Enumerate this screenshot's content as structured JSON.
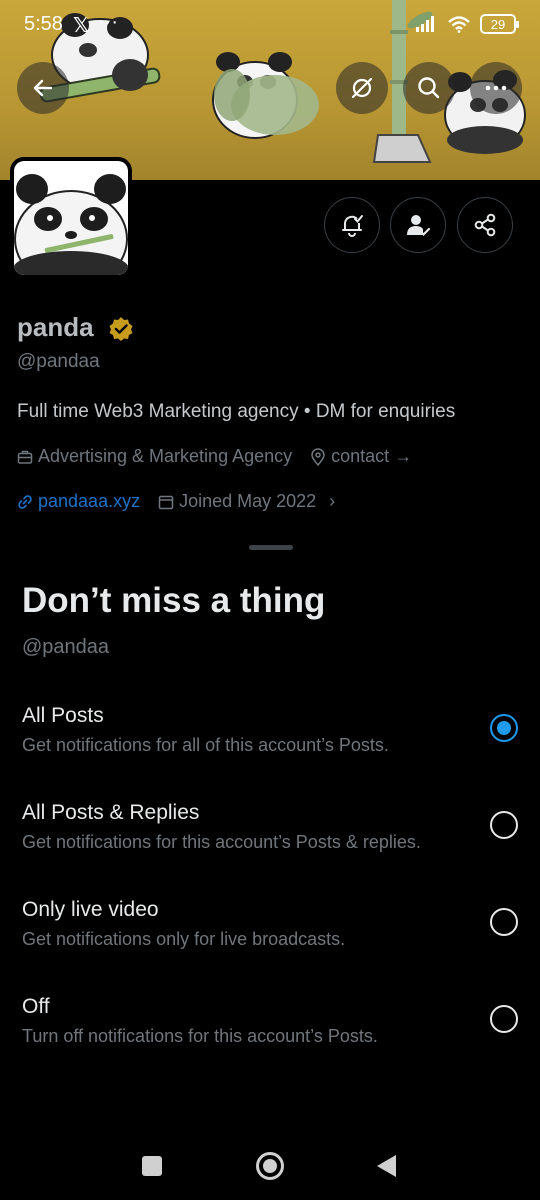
{
  "status_bar": {
    "time": "5:58",
    "x_glyph": "𝕏",
    "dots": "···",
    "battery": "29"
  },
  "header": {
    "back_icon": "arrow-left-icon",
    "grok_icon": "grok-icon",
    "search_icon": "search-icon",
    "more_icon": "more-horizontal-icon"
  },
  "profile": {
    "name": "panda",
    "handle": "@pandaa",
    "bio": "Full time Web3 Marketing agency • DM for enquiries",
    "category": "Advertising & Marketing Agency",
    "location": "contact",
    "location_arrow": "→",
    "website": "pandaaa.xyz",
    "joined": "Joined May 2022",
    "joined_chevron": "›",
    "verified_color": "#e2b719"
  },
  "actions": {
    "notify_icon": "bell-check-icon",
    "follow_icon": "person-check-icon",
    "share_icon": "share-icon"
  },
  "sheet": {
    "title": "Don’t miss a thing",
    "handle": "@pandaa",
    "options": [
      {
        "title": "All Posts",
        "desc": "Get notifications for all of this account’s Posts.",
        "selected": true
      },
      {
        "title": "All Posts & Replies",
        "desc": "Get notifications for this account’s Posts & replies.",
        "selected": false
      },
      {
        "title": "Only live video",
        "desc": "Get notifications only for live broadcasts.",
        "selected": false
      },
      {
        "title": "Off",
        "desc": "Turn off notifications for this account’s Posts.",
        "selected": false
      }
    ]
  },
  "colors": {
    "accent": "#1d9bf0",
    "link": "#1d72c9",
    "banner": "#c9a73a"
  }
}
